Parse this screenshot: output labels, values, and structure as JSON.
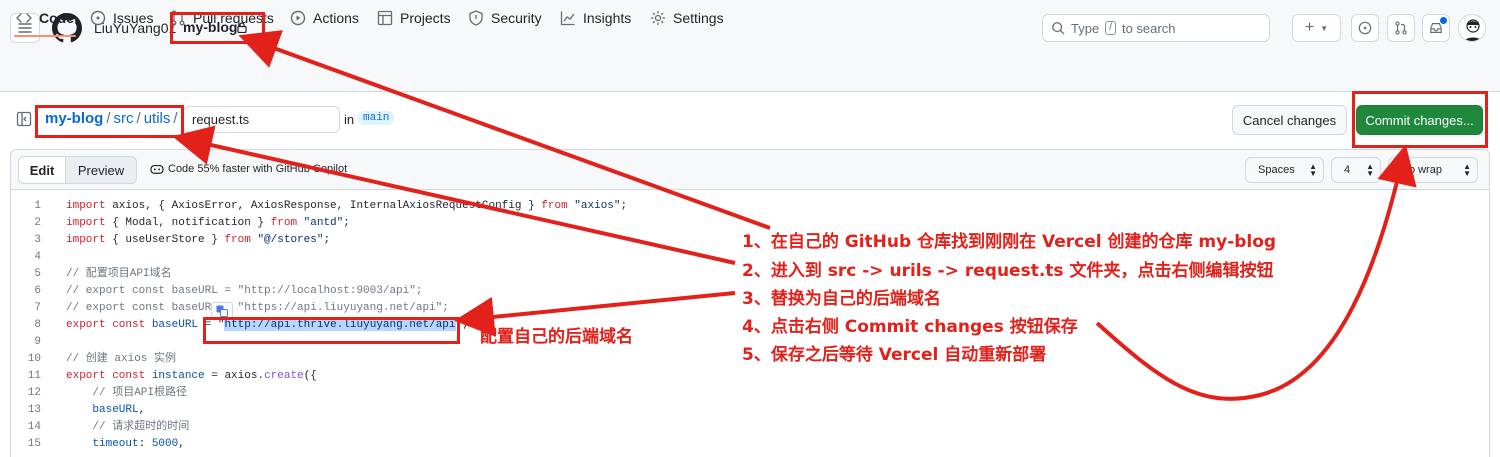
{
  "header": {
    "owner": "LiuYuYang01",
    "slash": "/",
    "repo": "my-blog",
    "search_placeholder_before": "Type",
    "search_kbd": "/",
    "search_placeholder_after": "to search"
  },
  "tabs": [
    {
      "label": "Code",
      "icon": "code-icon",
      "active": true
    },
    {
      "label": "Issues",
      "icon": "issue-icon"
    },
    {
      "label": "Pull requests",
      "icon": "pull-request-icon"
    },
    {
      "label": "Actions",
      "icon": "play-icon"
    },
    {
      "label": "Projects",
      "icon": "table-icon"
    },
    {
      "label": "Security",
      "icon": "shield-icon"
    },
    {
      "label": "Insights",
      "icon": "graph-icon"
    },
    {
      "label": "Settings",
      "icon": "gear-icon"
    }
  ],
  "editbar": {
    "crumbs": [
      "my-blog",
      "src",
      "utils"
    ],
    "sep": "/",
    "filename": "request.ts",
    "in_label": "in",
    "branch": "main",
    "cancel_label": "Cancel changes",
    "commit_label": "Commit changes..."
  },
  "editor": {
    "edit_label": "Edit",
    "preview_label": "Preview",
    "copilot_label": "Code 55% faster with GitHub Copilot",
    "indent_mode": "Spaces",
    "indent_size": "4",
    "wrap_mode": "No wrap",
    "line_numbers": [
      "1",
      "2",
      "3",
      "4",
      "5",
      "6",
      "7",
      "8",
      "9",
      "10",
      "11",
      "12",
      "13",
      "14",
      "15"
    ]
  },
  "annotations": {
    "steps": [
      "1、在自己的 GitHub 仓库找到刚刚在 Vercel 创建的仓库 my-blog",
      "2、进入到 src -> urils -> request.ts 文件夹，点击右侧编辑按钮",
      "3、替换为自己的后端域名",
      "4、点击右侧 Commit changes 按钮保存",
      "5、保存之后等待 Vercel 自动重新部署"
    ],
    "baseurl_note": "配置自己的后端域名",
    "color": "#e3211b"
  },
  "colors": {
    "commit_green": "#1f883d",
    "link_blue": "#0969da",
    "tab_underline": "#fd8c73"
  }
}
